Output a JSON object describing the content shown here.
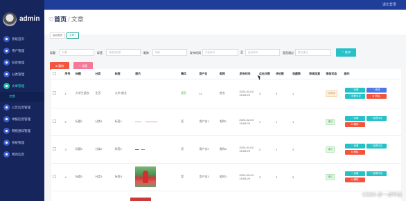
{
  "topbar": {
    "user_label": "退出登录"
  },
  "sidebar": {
    "username": "admin",
    "items": [
      {
        "label": "系统首页",
        "active": false
      },
      {
        "label": "用户管理",
        "active": false
      },
      {
        "label": "标签管理",
        "active": false
      },
      {
        "label": "分类管理",
        "active": false
      },
      {
        "label": "文章管理",
        "active": true,
        "children": [
          "文章"
        ]
      },
      {
        "label": "公告信息管理",
        "active": false
      },
      {
        "label": "举报信息管理",
        "active": false
      },
      {
        "label": "网络通知管理",
        "active": false
      },
      {
        "label": "系统管理",
        "active": false
      },
      {
        "label": "我的信息",
        "active": false
      }
    ]
  },
  "header": {
    "breadcrumb_home": "首页",
    "breadcrumb_sep": "/",
    "breadcrumb_current": "文章",
    "tags": [
      "后台首页",
      "文章 ×"
    ]
  },
  "filters": {
    "title_label": "标题",
    "title_placeholder": "标题",
    "tag_label": "标签",
    "tag_placeholder": "请选择标签",
    "author_label": "昵称",
    "author_placeholder": "昵称",
    "date_label": "发布时间",
    "date_start_placeholder": "开始时间",
    "date_sep": "至",
    "date_end_placeholder": "结束时间",
    "status_label": "是否通过",
    "status_placeholder": "是否通过",
    "search_label": "♡ 查询",
    "delete_label": "⊗ 删除",
    "report_label": "♡ 报表"
  },
  "table": {
    "headers": [
      "",
      "序号",
      "标题",
      "分类",
      "标签",
      "图片",
      "精华",
      "用户名",
      "昵称",
      "发布时间",
      "点击次数",
      "评论数",
      "收藏数",
      "审核回复",
      "审核状态",
      "操作"
    ],
    "rows": [
      {
        "index": "1",
        "title": "大学生留言",
        "category": "生活",
        "tag": "大学,就业",
        "image": "",
        "featured": "是否",
        "username": "11",
        "nickname": "姓名",
        "date": "2024-02-04 15:05:29",
        "clicks": "3",
        "comments": "0",
        "favorites": "1",
        "reply": "",
        "status": "待审核",
        "status_kind": "wait",
        "ops": [
          "♡ 查看",
          "♡ 修改",
          "♡ 查看评论",
          "⊗ 删除"
        ]
      },
      {
        "index": "2",
        "title": "标题1",
        "category": "分类1",
        "tag": "标签1",
        "image": "",
        "featured": "否",
        "username": "用户名1",
        "nickname": "昵称1",
        "date": "2024-02-04 15:05:29",
        "clicks": "1",
        "comments": "1",
        "favorites": "1",
        "reply": "",
        "status": "通过",
        "status_kind": "pass",
        "ops": [
          "♡ 查看",
          "♡ 查看评论",
          "⊗ 删除"
        ]
      },
      {
        "index": "3",
        "title": "标题2",
        "category": "分类2",
        "tag": "标签2",
        "image": "",
        "featured": "否",
        "username": "用户名2",
        "nickname": "昵称2",
        "date": "2024-02-04 15:05:29",
        "clicks": "2",
        "comments": "2",
        "favorites": "2",
        "reply": "",
        "status": "通过",
        "status_kind": "pass",
        "ops": [
          "♡ 查看",
          "♡ 查看评论",
          "⊗ 删除"
        ]
      },
      {
        "index": "4",
        "title": "标题3",
        "category": "分类3",
        "tag": "标签3",
        "image": "photo",
        "featured": "是",
        "username": "用户名3",
        "nickname": "昵称3",
        "date": "2024-02-04 15:05:29",
        "clicks": "3",
        "comments": "3",
        "favorites": "3",
        "reply": "",
        "status": "通过",
        "status_kind": "pass",
        "ops": [
          "♡ 查看",
          "♡ 查看评论",
          "⊗ 删除"
        ]
      }
    ]
  },
  "watermark": "CSDN @一点毕设",
  "colors": {
    "sidebar_bg": "#16255c",
    "topbar_bg": "#1f3e9a",
    "accent_teal": "#25c1c7",
    "danger": "#f2553e"
  }
}
